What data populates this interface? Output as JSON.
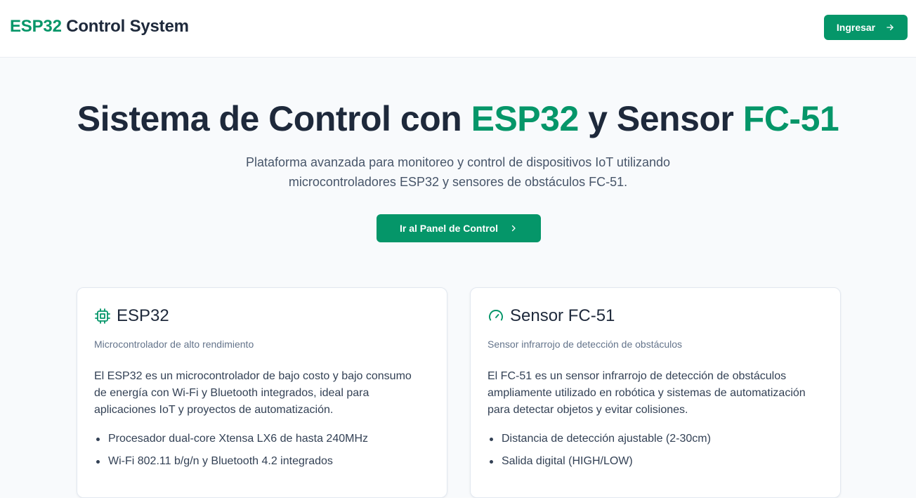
{
  "header": {
    "brand_accent": "ESP32",
    "brand_rest": " Control System",
    "login_label": "Ingresar"
  },
  "hero": {
    "title_part1": "Sistema de Control con ",
    "title_accent1": "ESP32",
    "title_part2": " y Sensor ",
    "title_accent2": "FC-51",
    "subtitle": "Plataforma avanzada para monitoreo y control de dispositivos IoT utilizando microcontroladores ESP32 y sensores de obstáculos FC-51.",
    "cta_label": "Ir al Panel de Control"
  },
  "cards": [
    {
      "icon": "chip-icon",
      "title": "ESP32",
      "description": "Microcontrolador de alto rendimiento",
      "body": "El ESP32 es un microcontrolador de bajo costo y bajo consumo de energía con Wi-Fi y Bluetooth integrados, ideal para aplicaciones IoT y proyectos de automatización.",
      "features": [
        "Procesador dual-core Xtensa LX6 de hasta 240MHz",
        "Wi-Fi 802.11 b/g/n y Bluetooth 4.2 integrados"
      ]
    },
    {
      "icon": "gauge-icon",
      "title": "Sensor FC-51",
      "description": "Sensor infrarrojo de detección de obstáculos",
      "body": "El FC-51 es un sensor infrarrojo de detección de obstáculos ampliamente utilizado en robótica y sistemas de automatización para detectar objetos y evitar colisiones.",
      "features": [
        "Distancia de detección ajustable (2-30cm)",
        "Salida digital (HIGH/LOW)"
      ]
    }
  ],
  "colors": {
    "accent": "#059669",
    "text_dark": "#1e293b",
    "text_muted": "#64748b",
    "background": "#f8fafc"
  }
}
